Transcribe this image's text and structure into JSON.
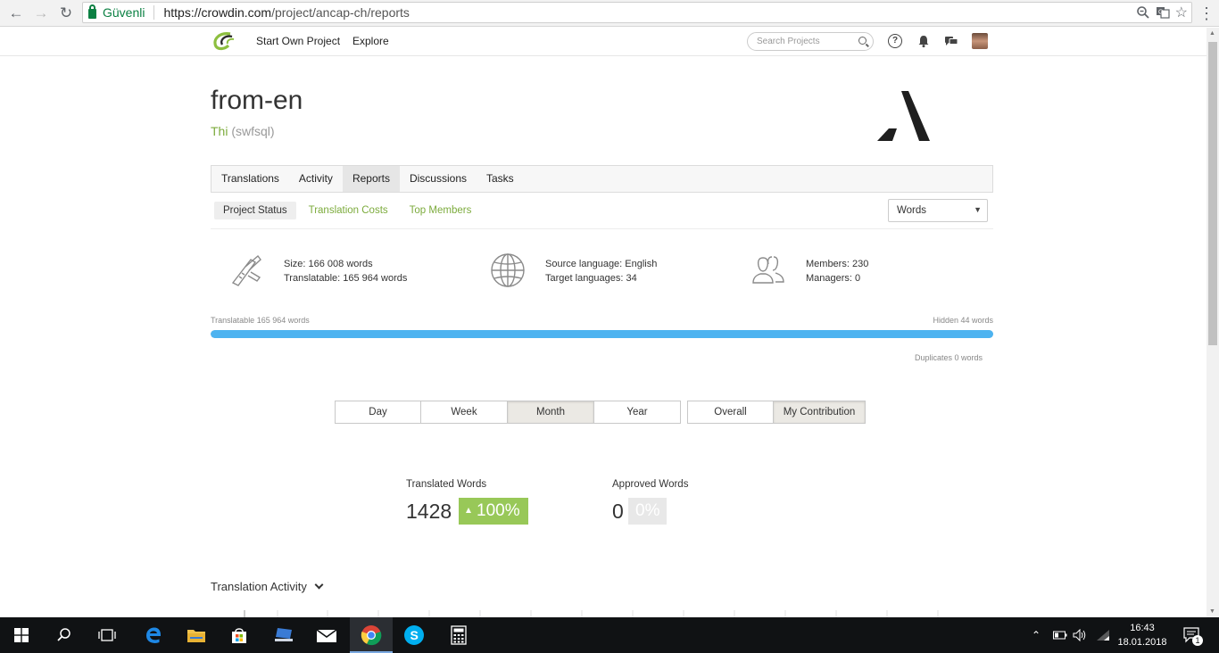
{
  "browser": {
    "secure_label": "Güvenli",
    "url_host": "https://crowdin.com",
    "url_path": "/project/ancap-ch/reports"
  },
  "header": {
    "start_own_project": "Start Own Project",
    "explore": "Explore",
    "search_placeholder": "Search Projects",
    "help_glyph": "?"
  },
  "project": {
    "title": "from-en",
    "owner_name": "Thi",
    "owner_username": "(swfsql)"
  },
  "tabs": [
    {
      "label": "Translations",
      "active": false
    },
    {
      "label": "Activity",
      "active": false
    },
    {
      "label": "Reports",
      "active": true
    },
    {
      "label": "Discussions",
      "active": false
    },
    {
      "label": "Tasks",
      "active": false
    }
  ],
  "subtabs": [
    {
      "label": "Project Status",
      "active": true
    },
    {
      "label": "Translation Costs",
      "active": false
    },
    {
      "label": "Top Members",
      "active": false
    }
  ],
  "unit_select": {
    "value": "Words",
    "caret": "▼"
  },
  "stats": {
    "size": "Size: 166 008 words",
    "translatable": "Translatable: 165 964 words",
    "source_language": "Source language: English",
    "target_languages": "Target languages: 34",
    "members": "Members: 230",
    "managers": "Managers: 0"
  },
  "progress": {
    "left_label": "Translatable 165 964 words",
    "right_label": "Hidden 44 words",
    "translatable_fraction": 0.9997,
    "duplicates_label": "Duplicates 0 words",
    "color": "#4db3f0"
  },
  "period_buttons": [
    {
      "label": "Day",
      "active": false
    },
    {
      "label": "Week",
      "active": false
    },
    {
      "label": "Month",
      "active": true
    },
    {
      "label": "Year",
      "active": false
    }
  ],
  "scope_buttons": [
    {
      "label": "Overall",
      "active": false
    },
    {
      "label": "My Contribution",
      "active": true
    }
  ],
  "counters": {
    "translated_label": "Translated Words",
    "translated_value": "1428",
    "translated_percent": "100%",
    "approved_label": "Approved Words",
    "approved_value": "0",
    "approved_percent": "0%",
    "accent": "#98c858"
  },
  "section_title": "Translation Activity",
  "taskbar": {
    "clock_time": "16:43",
    "clock_date": "18.01.2018",
    "notification_count": "1"
  }
}
